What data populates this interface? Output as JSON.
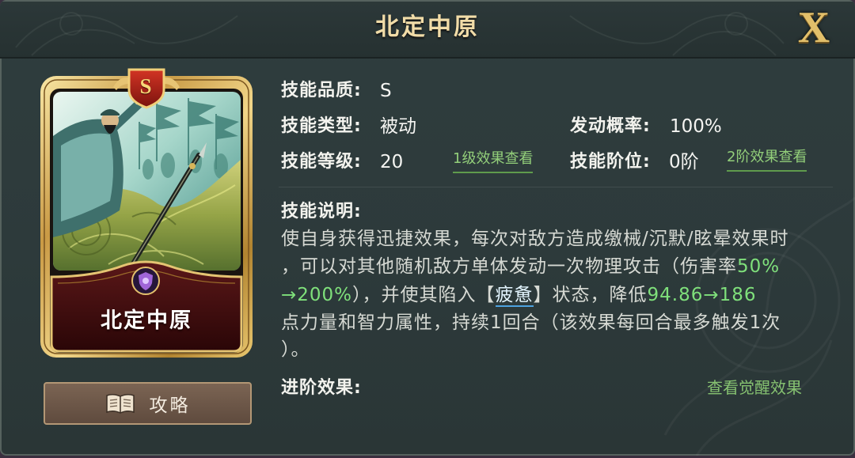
{
  "header": {
    "title": "北定中原",
    "close_label": "X"
  },
  "card": {
    "grade_badge": "S",
    "name": "北定中原"
  },
  "guide_button": {
    "label": "攻略"
  },
  "info": {
    "quality_label": "技能品质:",
    "quality_value": "S",
    "type_label": "技能类型:",
    "type_value": "被动",
    "rate_label": "发动概率:",
    "rate_value": "100%",
    "level_label": "技能等级:",
    "level_value": "20",
    "level_link": "1级效果查看",
    "tier_label": "技能阶位:",
    "tier_value": "0阶",
    "tier_link": "2阶效果查看"
  },
  "description": {
    "label": "技能说明:",
    "lines": [
      [
        "使自身获得迅捷效果，每次对敌方造成缴械/沉默/眩晕效果时"
      ],
      [
        "，可以对其他随机敌方单体发动一次物理攻击（伤害率",
        "50%"
      ],
      [
        "→200%",
        "），并使其陷入【",
        "疲惫",
        "】状态，降低",
        "94.86→186"
      ],
      [
        "点力量和智力属性，持续1回合（该效果每回合最多触发1次"
      ],
      [
        "）。"
      ]
    ]
  },
  "advance": {
    "label": "进阶效果:",
    "link": "查看觉醒效果"
  },
  "icons": {
    "close": "close-icon",
    "grade_badge": "shield-badge-icon",
    "emblem": "purple-emblem-icon",
    "guide": "book-icon"
  },
  "colors": {
    "panel_bg": "#2e3b3c",
    "title_gold": "#f1dca8",
    "highlight_green": "#7fe07b",
    "link_green": "#93cf7a",
    "keyword": "#e3f5ff",
    "nameplate": "#4a1214"
  }
}
